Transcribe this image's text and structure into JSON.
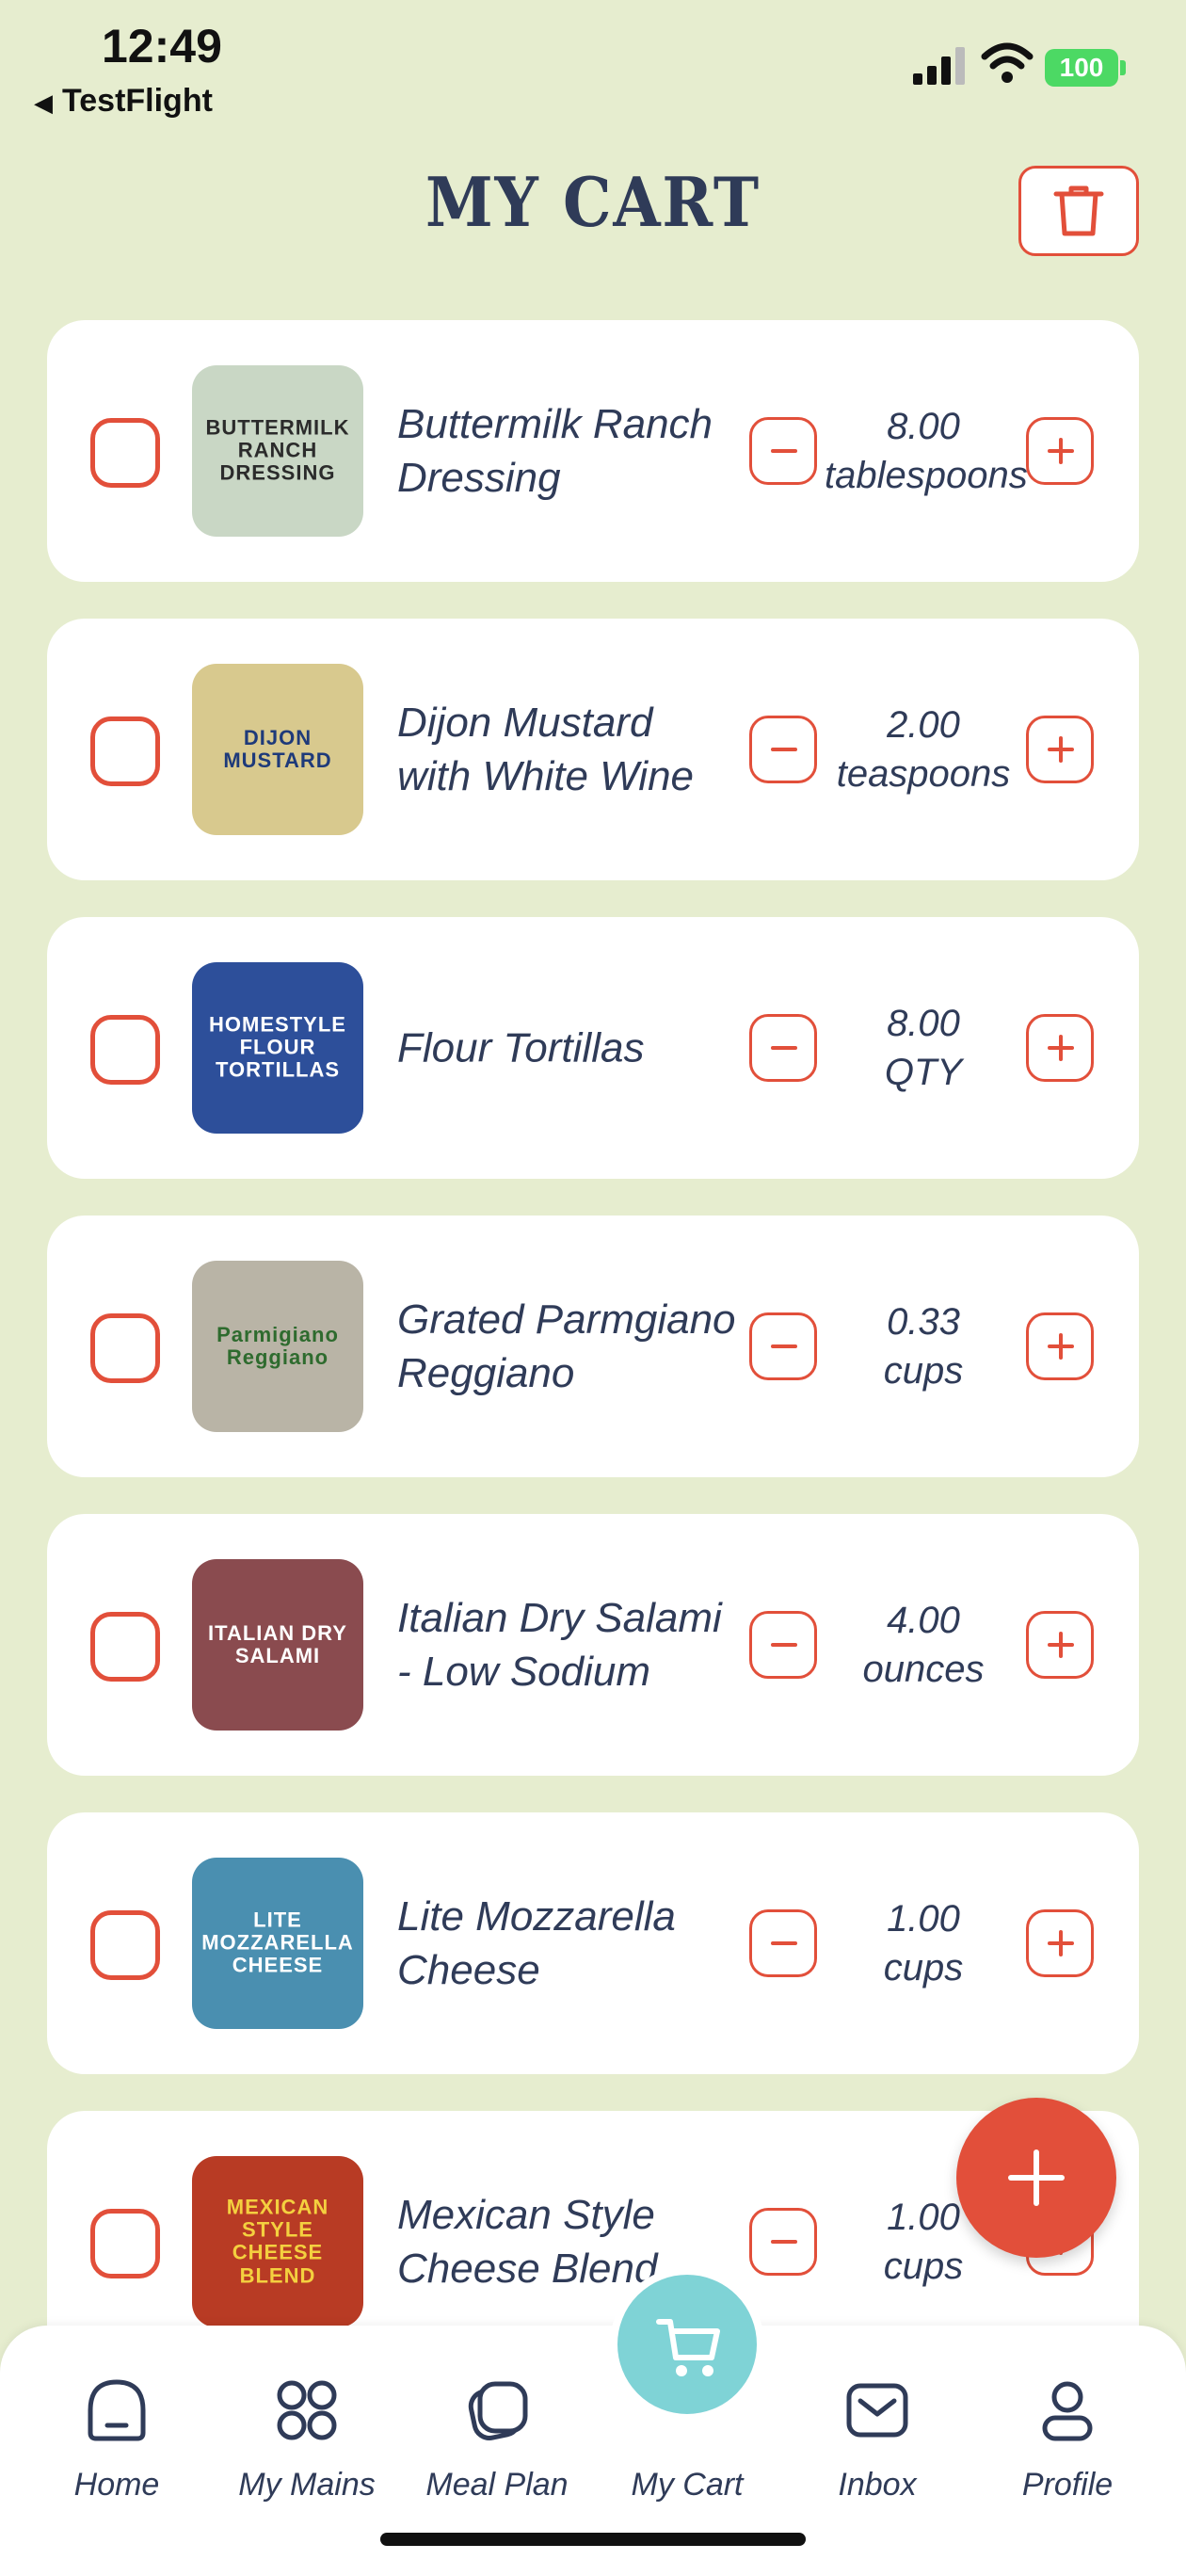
{
  "status_bar": {
    "time": "12:49",
    "back_app": "TestFlight",
    "battery": "100"
  },
  "header": {
    "title": "MY CART"
  },
  "cart_items": [
    {
      "name": "Buttermilk Ranch Dressing",
      "qty_value": "8.00",
      "qty_unit": "tablespoons",
      "thumb_text": "BUTTERMILK\nRANCH\nDRESSING",
      "thumb_bg": "#c9d7c5",
      "thumb_fg": "#2b2b2b"
    },
    {
      "name": "Dijon Mustard with White Wine",
      "qty_value": "2.00",
      "qty_unit": "teaspoons",
      "thumb_text": "DIJON\nMUSTARD",
      "thumb_bg": "#d8c98e",
      "thumb_fg": "#1e3a7a"
    },
    {
      "name": "Flour Tortillas",
      "qty_value": "8.00",
      "qty_unit": "QTY",
      "thumb_text": "HOMESTYLE\nFLOUR\nTORTILLAS",
      "thumb_bg": "#2d4f9a",
      "thumb_fg": "#ffffff"
    },
    {
      "name": "Grated Parmgiano Reggiano",
      "qty_value": "0.33",
      "qty_unit": "cups",
      "thumb_text": "Parmigiano\nReggiano",
      "thumb_bg": "#b9b4a6",
      "thumb_fg": "#2e6b2e"
    },
    {
      "name": "Italian Dry Salami - Low Sodium",
      "qty_value": "4.00",
      "qty_unit": "ounces",
      "thumb_text": "ITALIAN DRY\nSALAMI",
      "thumb_bg": "#8a4b4f",
      "thumb_fg": "#ffffff"
    },
    {
      "name": "Lite Mozzarella Cheese",
      "qty_value": "1.00",
      "qty_unit": "cups",
      "thumb_text": "LITE\nMOZZARELLA\nCHEESE",
      "thumb_bg": "#4a8fb0",
      "thumb_fg": "#ffffff"
    },
    {
      "name": "Mexican Style Cheese Blend",
      "qty_value": "1.00",
      "qty_unit": "cups",
      "thumb_text": "MEXICAN\nSTYLE\nCHEESE BLEND",
      "thumb_bg": "#b83b24",
      "thumb_fg": "#f4d03f"
    }
  ],
  "tabs": [
    {
      "label": "Home",
      "icon": "home-icon"
    },
    {
      "label": "My Mains",
      "icon": "grid-icon"
    },
    {
      "label": "Meal Plan",
      "icon": "meal-plan-icon"
    },
    {
      "label": "My Cart",
      "icon": "cart-icon"
    },
    {
      "label": "Inbox",
      "icon": "inbox-icon"
    },
    {
      "label": "Profile",
      "icon": "profile-icon"
    }
  ],
  "colors": {
    "background": "#e6edcf",
    "accent": "#e24f3a",
    "text": "#2f3b58",
    "cart_tab": "#7fd3d6"
  }
}
